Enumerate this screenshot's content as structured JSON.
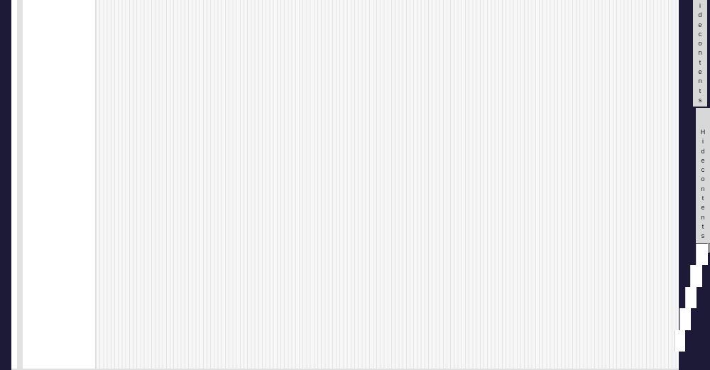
{
  "sidebar": {
    "toc_toggle_1": [
      "i",
      "d",
      "e",
      "c",
      "o",
      "n",
      "t",
      "e",
      "n",
      "t",
      "s"
    ],
    "toc_toggle_2": [
      "H",
      "i",
      "d",
      "e",
      "c",
      "o",
      "n",
      "t",
      "e",
      "n",
      "t",
      "s"
    ]
  },
  "colors": {
    "frame": "#1c1a36",
    "page": "#ffffff",
    "stripe": "#e4e4e4",
    "tab": "#d8d8d8"
  }
}
